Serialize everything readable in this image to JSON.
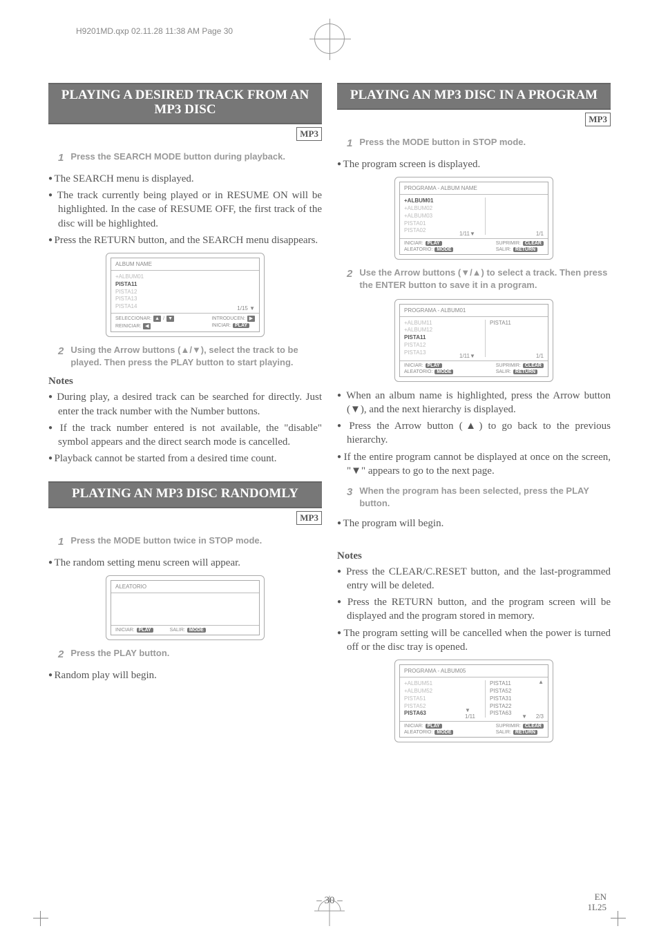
{
  "header_line": "H9201MD.qxp  02.11.28 11:38 AM  Page 30",
  "s1": {
    "title": "PLAYING A DESIRED TRACK FROM AN MP3 DISC",
    "badge": "MP3",
    "step1": "Press the SEARCH MODE button during playback.",
    "bullets_a": [
      "The SEARCH menu is displayed.",
      "The track currently being played or in RESUME ON will be highlighted. In the case of RESUME OFF, the first track of the disc will be highlighted.",
      "Press the RETURN button, and the SEARCH menu disappears."
    ],
    "panel": {
      "title": "ALBUM NAME",
      "lines": [
        "+ALBUM01",
        "PISTA11",
        "PISTA12",
        "PISTA13",
        "PISTA14"
      ],
      "highlight_index": 1,
      "page_left": "",
      "page_right": "1/15 ▼",
      "foot_left": [
        {
          "label": "SELECCIONAR:",
          "icons": [
            "▲",
            "▼"
          ]
        },
        {
          "label": "REINICIAR:",
          "icons": [
            "◀"
          ]
        }
      ],
      "foot_right": [
        {
          "label": "INTRODUCEN:",
          "icons": [
            "▶"
          ]
        },
        {
          "label": "INICIAR:",
          "pill": "PLAY"
        }
      ]
    },
    "step2": "Using the Arrow buttons (▲/▼), select the track to be played. Then press the PLAY button to start playing.",
    "notes_h": "Notes",
    "notes": [
      "During play, a desired track can be searched for directly. Just enter the track number with the Number buttons.",
      "If the track number entered is not available, the \"disable\" symbol appears and the direct search mode is cancelled.",
      "Playback cannot be started from a desired time count."
    ]
  },
  "s2": {
    "title": "PLAYING AN MP3 DISC RANDOMLY",
    "badge": "MP3",
    "step1": "Press the MODE button twice in STOP mode.",
    "bullet1": "The random setting menu screen will appear.",
    "panel": {
      "title": "ALEATORIO",
      "foot": [
        {
          "label": "INICIAR:",
          "pill": "PLAY"
        },
        {
          "label": "SALIR:",
          "pill": "MODE"
        }
      ]
    },
    "step2": "Press the PLAY button.",
    "bullet2": "Random play will begin."
  },
  "s3": {
    "title": "PLAYING AN MP3 DISC IN A PROGRAM",
    "badge": "MP3",
    "step1": "Press the MODE button in STOP mode.",
    "bullet1": "The program screen is displayed.",
    "panelA": {
      "title": "PROGRAMA - ALBUM NAME",
      "lines": [
        "+ALBUM01",
        "+ALBUM02",
        "+ALBUM03",
        "PISTA01",
        "PISTA02"
      ],
      "highlight_index": 0,
      "page_left": "1/11▼",
      "page_right": "1/1",
      "foot_left": [
        {
          "label": "INICIAR:",
          "pill": "PLAY"
        },
        {
          "label": "ALEATORIO:",
          "pill": "MODE"
        }
      ],
      "foot_right": [
        {
          "label": "SUPRIMIR:",
          "pill": "CLEAR"
        },
        {
          "label": "SALIR:",
          "pill": "RETURN"
        }
      ]
    },
    "step2": "Use the Arrow buttons (▼/▲) to select a track. Then press the ENTER button to save it in a program.",
    "panelB": {
      "title": "PROGRAMA - ALBUM01",
      "lines": [
        "+ALBUM11",
        "+ALBUM12",
        "PISTA11",
        "PISTA12",
        "PISTA13"
      ],
      "highlight_index": 2,
      "right_lines": [
        "PISTA11"
      ],
      "page_left": "1/11▼",
      "page_right": "1/1",
      "foot_left": [
        {
          "label": "INICIAR:",
          "pill": "PLAY"
        },
        {
          "label": "ALEATORIO:",
          "pill": "MODE"
        }
      ],
      "foot_right": [
        {
          "label": "SUPRIMIR:",
          "pill": "CLEAR"
        },
        {
          "label": "SALIR:",
          "pill": "RETURN"
        }
      ]
    },
    "bullets_b": [
      "When an album name is highlighted, press the Arrow button (▼), and the next hierarchy is displayed.",
      "Press the Arrow button (▲) to go back to the previous hierarchy.",
      "If the entire program cannot be displayed at once on the screen, \"▼\" appears to go to the next page."
    ],
    "step3": "When the program has been selected, press the PLAY button.",
    "bullet3": "The program will begin.",
    "notes_h": "Notes",
    "notes": [
      "Press the CLEAR/C.RESET button, and the last-programmed entry will be deleted.",
      "Press the RETURN button, and the program screen will be displayed and the program stored in memory.",
      "The program setting will be cancelled when the power is turned off or the disc tray is opened."
    ],
    "panelC": {
      "title": "PROGRAMA - ALBUM05",
      "lines": [
        "+ALBUM51",
        "+ALBUM52",
        "PISTA51",
        "PISTA52",
        "PISTA63"
      ],
      "highlight_index": 4,
      "right_lines": [
        "PISTA11",
        "PISTA52",
        "PISTA31",
        "PISTA22",
        "PISTA63"
      ],
      "right_arrow_up": "▲",
      "right_arrow_down": "▼",
      "page_left": "1/11",
      "page_arrow_left": "▼",
      "page_right": "2/3",
      "foot_left": [
        {
          "label": "INICIAR:",
          "pill": "PLAY"
        },
        {
          "label": "ALEATORIO:",
          "pill": "MODE"
        }
      ],
      "foot_right": [
        {
          "label": "SUPRIMIR:",
          "pill": "CLEAR"
        },
        {
          "label": "SALIR:",
          "pill": "RETURN"
        }
      ]
    }
  },
  "page_number": "– 30 –",
  "footer_en": "EN",
  "footer_code": "1L25"
}
